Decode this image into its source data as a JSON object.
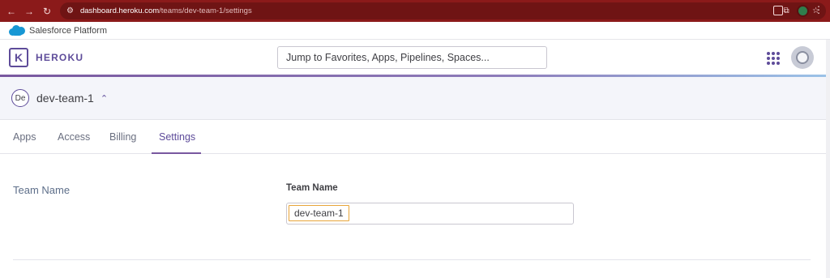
{
  "browser": {
    "url_host": "dashboard.heroku.com",
    "url_path": "/teams/dev-team-1/settings",
    "nav_icons": [
      "back-icon",
      "forward-icon",
      "reload-icon"
    ]
  },
  "salesforce_bar": {
    "label": "Salesforce Platform"
  },
  "header": {
    "logo_letter": "K",
    "brand": "HEROKU",
    "search_placeholder": "Jump to Favorites, Apps, Pipelines, Spaces..."
  },
  "team": {
    "badge": "De",
    "name": "dev-team-1",
    "chevron": "⌃⌄"
  },
  "tabs": [
    {
      "label": "Apps"
    },
    {
      "label": "Access"
    },
    {
      "label": "Billing"
    },
    {
      "label": "Settings",
      "active": true
    }
  ],
  "settings": {
    "section_label": "Team Name",
    "field_label": "Team Name",
    "field_value": "dev-team-1"
  },
  "colors": {
    "accent": "#79589f",
    "browser_chrome": "#8b1a1a",
    "focus": "#e8a53a"
  }
}
